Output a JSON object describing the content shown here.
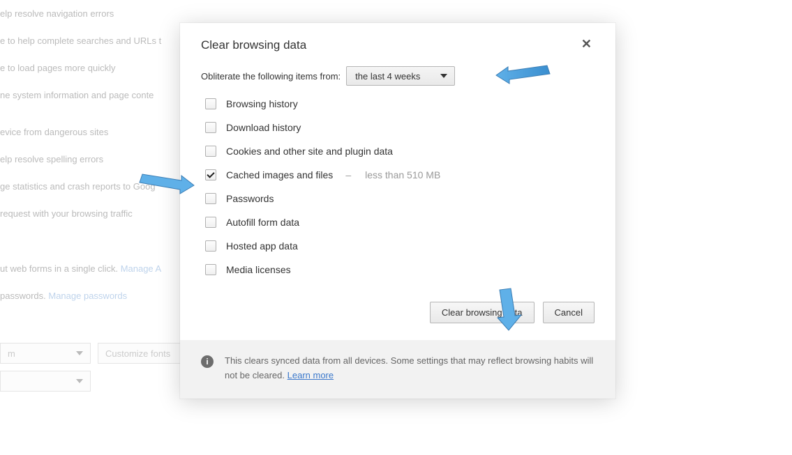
{
  "background": {
    "lines": [
      "elp resolve navigation errors",
      "e to help complete searches and URLs t",
      "e to load pages more quickly",
      "ne system information and page conte",
      "evice from dangerous sites",
      "elp resolve spelling errors",
      "ge statistics and crash reports to Goog",
      "request with your browsing traffic"
    ],
    "forms_line_pre": "ut web forms in a single click. ",
    "forms_link": "Manage A",
    "passwords_line_pre": " passwords. ",
    "passwords_link": "Manage passwords",
    "dropdown1": "m",
    "dropdown2_placeholder": "Customize fonts",
    "dropdown3": ""
  },
  "dialog": {
    "title": "Clear browsing data",
    "obliterate_label": "Obliterate the following items from:",
    "time_range_selected": "the last 4 weeks",
    "checkboxes": [
      {
        "label": "Browsing history",
        "checked": false
      },
      {
        "label": "Download history",
        "checked": false
      },
      {
        "label": "Cookies and other site and plugin data",
        "checked": false
      },
      {
        "label": "Cached images and files",
        "checked": true,
        "note": "less than 510 MB"
      },
      {
        "label": "Passwords",
        "checked": false
      },
      {
        "label": "Autofill form data",
        "checked": false
      },
      {
        "label": "Hosted app data",
        "checked": false
      },
      {
        "label": "Media licenses",
        "checked": false
      }
    ],
    "primary_button": "Clear browsing data",
    "cancel_button": "Cancel",
    "footer_text_pre": "This clears synced data from all devices. Some settings that may reflect browsing habits will not be cleared. ",
    "footer_link": "Learn more"
  },
  "annotations": {
    "arrow_to_select": true,
    "arrow_to_cached_checkbox": true,
    "arrow_to_clear_button": true
  }
}
